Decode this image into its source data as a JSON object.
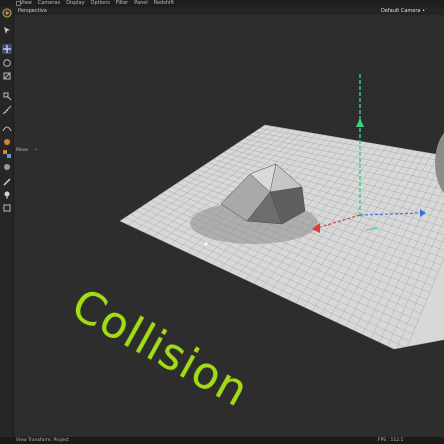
{
  "menu": {
    "items": [
      "View",
      "Cameras",
      "Display",
      "Options",
      "Filter",
      "Panel",
      "Redshift"
    ]
  },
  "viewport": {
    "title": "Perspective",
    "camera": "Default Camera •˙"
  },
  "attributes": {
    "label": "Move",
    "plus": "+"
  },
  "status": {
    "left": "View Transform: Project",
    "right": "FPS : 112.1"
  },
  "scene": {
    "overlay_text": "Collision",
    "overlay_color": "#a3db17",
    "axis_colors": {
      "x": "#e03b3b",
      "y": "#37d27a",
      "z": "#3b6fe0"
    }
  },
  "toolbar": {
    "icons": [
      "move-icon",
      "select-icon",
      "move-axis-icon",
      "rotate-icon",
      "scale-icon",
      "snap-icon",
      "measure-icon",
      "spline-icon",
      "generator-icon",
      "deformer-icon",
      "material-icon",
      "light-icon",
      "paint-icon",
      "render-icon"
    ]
  }
}
